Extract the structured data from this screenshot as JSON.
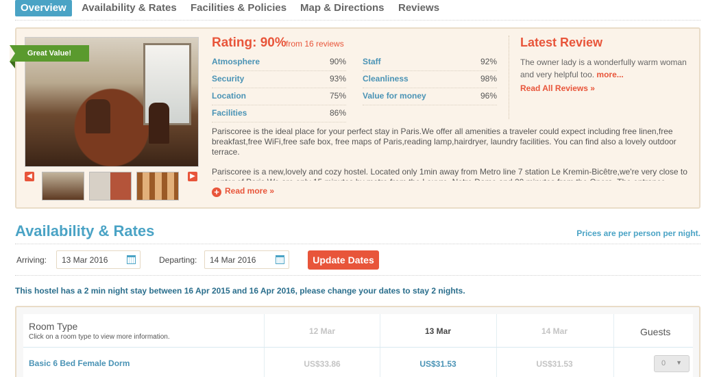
{
  "nav": {
    "tabs": [
      "Overview",
      "Availability & Rates",
      "Facilities & Policies",
      "Map & Directions",
      "Reviews"
    ],
    "active": "Overview"
  },
  "overview": {
    "badge": "Great Value!",
    "gallery": {
      "prev_icon": "chevron-left-icon",
      "next_icon": "chevron-right-icon",
      "thumbnails": 3
    },
    "rating": {
      "title": "Rating: 90%",
      "sub": "from 16 reviews"
    },
    "scores_left": [
      {
        "label": "Atmosphere",
        "value": "90%"
      },
      {
        "label": "Security",
        "value": "93%"
      },
      {
        "label": "Location",
        "value": "75%"
      },
      {
        "label": "Facilities",
        "value": "86%"
      }
    ],
    "scores_right": [
      {
        "label": "Staff",
        "value": "92%"
      },
      {
        "label": "Cleanliness",
        "value": "98%"
      },
      {
        "label": "Value for money",
        "value": "96%"
      }
    ],
    "review": {
      "title": "Latest Review",
      "text": "The owner lady is a wonderfully warm woman and very helpful too.",
      "more": "more...",
      "all": "Read All Reviews »"
    },
    "description": [
      "Pariscoree is the ideal place for your perfect stay in Paris.We offer all amenities a traveler could expect including free linen,free breakfast,free WiFi,free safe box, free maps of Paris,reading lamp,hairdryer, laundry facilities. You can find also a lovely outdoor terrace.",
      "Pariscoree is a new,lovely and cozy hostel. Located only 1min away from Metro line 7 station Le Kremin-Bicêtre,we're very close to center of Paris.We are only 15 minutes by metro from the Louvre, Notre Dame and 20 minutes from the Opera. The entrance"
    ],
    "read_more": "Read more »"
  },
  "availability": {
    "title": "Availability & Rates",
    "note": "Prices are per person per night.",
    "arriving_label": "Arriving:",
    "arriving_value": "13 Mar 2016",
    "departing_label": "Departing:",
    "departing_value": "14 Mar 2016",
    "update_button": "Update Dates",
    "min_stay": "This hostel has a 2 min night stay between 16 Apr 2015 and 16 Apr 2016, please change your dates to stay 2 nights."
  },
  "rates_table": {
    "room_type_header": "Room Type",
    "room_type_sub": "Click on a room type to view more information.",
    "dates": [
      "12 Mar",
      "13 Mar",
      "14 Mar"
    ],
    "guests_header": "Guests",
    "rows": [
      {
        "room": "Basic 6 Bed Female Dorm",
        "prices": [
          "US$33.86",
          "US$31.53",
          "US$31.53"
        ],
        "guests": "0"
      }
    ]
  },
  "colors": {
    "accent": "#4aa3c5",
    "highlight": "#e8553a",
    "badge": "#5a9a2e"
  }
}
